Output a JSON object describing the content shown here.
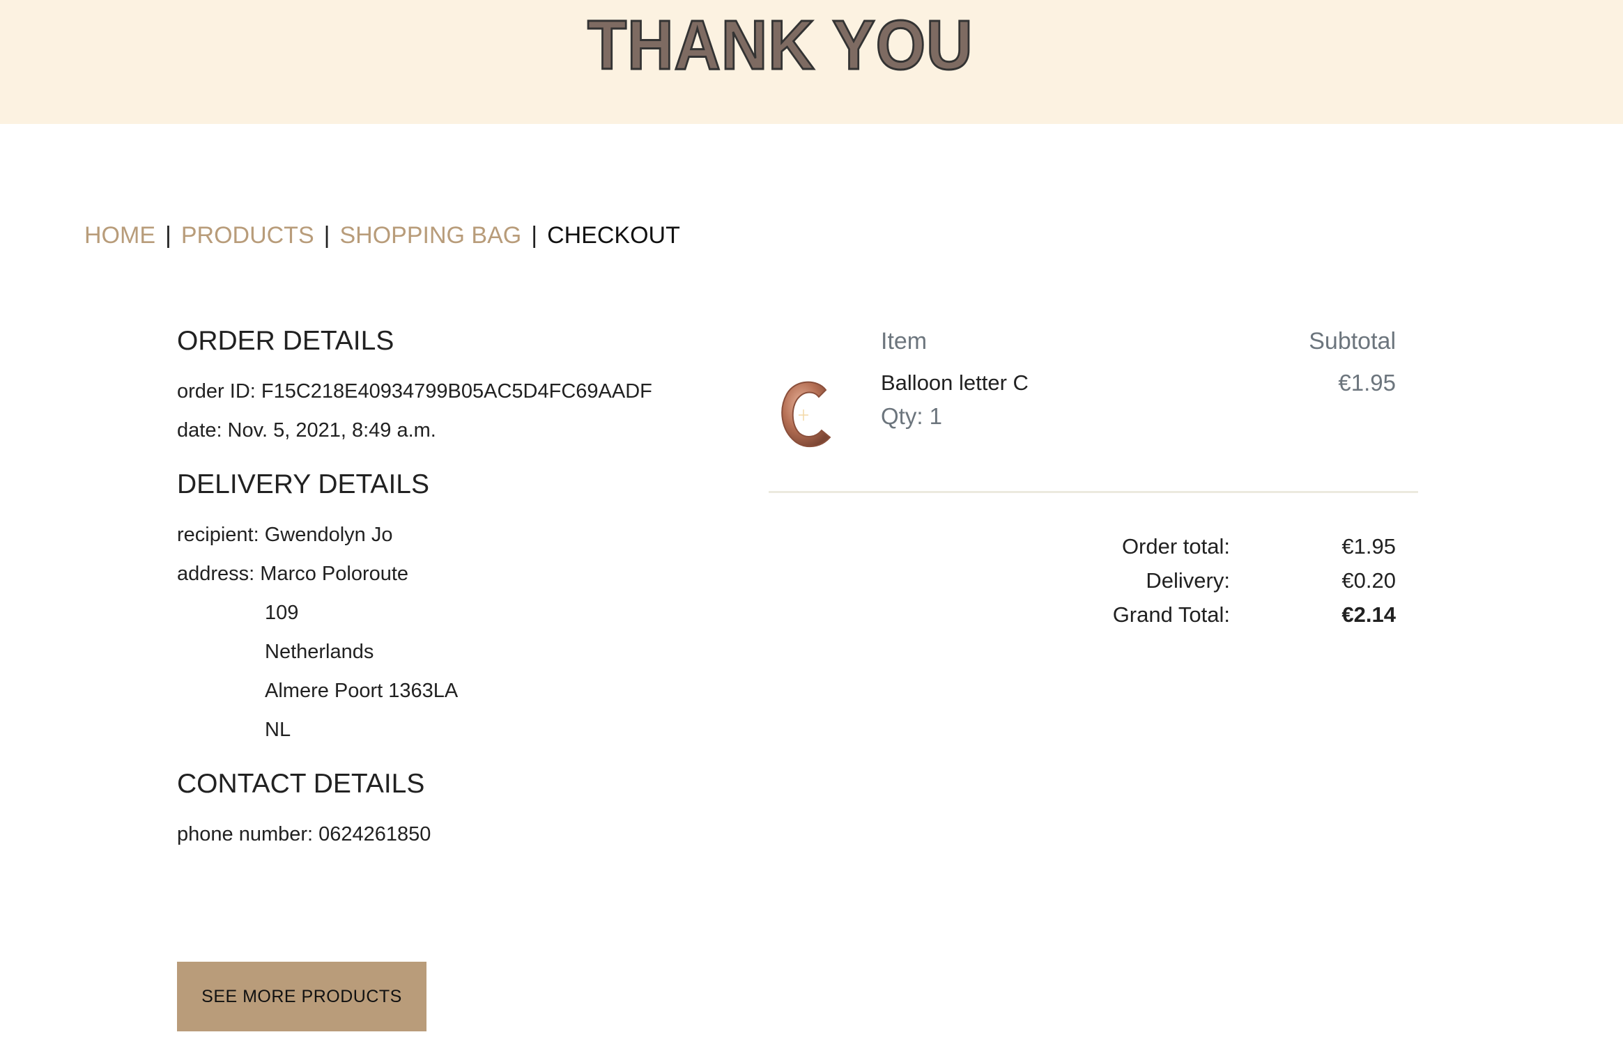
{
  "banner": {
    "title": "THANK YOU"
  },
  "breadcrumb": {
    "items": [
      {
        "label": "HOME"
      },
      {
        "label": "PRODUCTS"
      },
      {
        "label": "SHOPPING BAG"
      },
      {
        "label": "CHECKOUT"
      }
    ],
    "separator": "|"
  },
  "order_details": {
    "title": "ORDER DETAILS",
    "order_id": "order ID: F15C218E40934799B05AC5D4FC69AADF",
    "date": "date: Nov. 5, 2021, 8:49 a.m."
  },
  "delivery_details": {
    "title": "DELIVERY DETAILS",
    "recipient": "recipient: Gwendolyn Jo",
    "address_lines": [
      "address: Marco Poloroute",
      "109",
      "Netherlands",
      "Almere Poort 1363LA",
      "NL"
    ]
  },
  "contact_details": {
    "title": "CONTACT DETAILS",
    "phone": "phone number: 0624261850"
  },
  "cart": {
    "header_item": "Item",
    "header_subtotal": "Subtotal",
    "item": {
      "name": "Balloon letter C",
      "qty": "Qty: 1",
      "price": "€1.95",
      "thumbnail_icon": "balloon-letter-c-image",
      "thumbnail_color": "#b56f54"
    }
  },
  "totals": {
    "order_total_label": "Order total:",
    "order_total_value": "€1.95",
    "delivery_label": "Delivery:",
    "delivery_value": "€0.20",
    "grand_total_label": "Grand Total:",
    "grand_total_value": "€2.14"
  },
  "cta": {
    "label": "SEE MORE PRODUCTS"
  },
  "colors": {
    "banner_bg": "#fcf2e1",
    "accent": "#b99c7a",
    "link": "#b89c7a",
    "divider": "#eceadf"
  }
}
